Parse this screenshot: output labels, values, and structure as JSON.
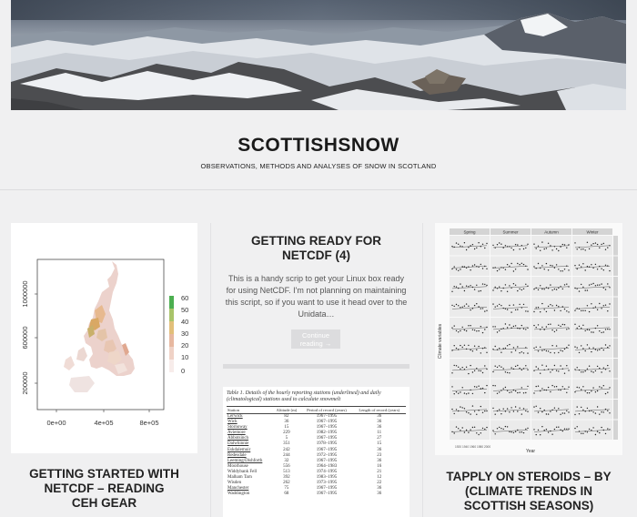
{
  "site": {
    "title": "SCOTTISHSNOW",
    "tagline": "OBSERVATIONS, METHODS AND ANALYSES OF SNOW IN SCOTLAND"
  },
  "posts": [
    {
      "title_lines": [
        "GETTING STARTED WITH",
        "NETCDF – READING",
        "CEH GEAR"
      ],
      "map_plot": {
        "y_ticks": [
          "1000000",
          "600000",
          "200000"
        ],
        "x_ticks": [
          "0e+00",
          "4e+05",
          "8e+05"
        ],
        "legend_ticks": [
          "60",
          "50",
          "40",
          "30",
          "20",
          "10",
          "0"
        ]
      }
    },
    {
      "title_lines": [
        "GETTING READY FOR",
        "NETCDF (4)"
      ],
      "excerpt": "This is a handy scrip to get your Linux box ready for using NetCDF. I'm not planning on maintaining this script, so if you want to use it head over to the Unidata…",
      "continue_label_1": "Continue",
      "continue_label_2": "reading →",
      "table": {
        "caption": "Table 1. Details of the hourly reporting stations (underlined) and daily (climatological) stations used to calculate snowmelt",
        "headers": [
          "Station",
          "Altitude (m)",
          "Period of record (years)",
          "Length of record (years)"
        ],
        "rows": [
          [
            "Lerwick",
            "82",
            "1967–1995",
            "36"
          ],
          [
            "Wick",
            "36",
            "1967–1995",
            "36"
          ],
          [
            "Stornoway",
            "15",
            "1967–1995",
            "36"
          ],
          [
            "Aviemore",
            "229",
            "1982–1995",
            "11"
          ],
          [
            "Abbotsinch",
            "5",
            "1967–1995",
            "27"
          ],
          [
            "Dalwhinnie",
            "351",
            "1978–1995",
            "15"
          ],
          [
            "Eskdalemuir",
            "242",
            "1967–1995",
            "36"
          ],
          [
            "Redesdale",
            "244",
            "1972–1995",
            "23"
          ],
          [
            "Leeming/Dishforth",
            "32",
            "1967–1995",
            "36"
          ],
          [
            "Moorhouse",
            "556",
            "1964–1983",
            "16"
          ],
          [
            "Widdybank Fell",
            "513",
            "1974–1995",
            "21"
          ],
          [
            "Malham Tarn",
            "392",
            "1983–1995",
            "12"
          ],
          [
            "Wisden",
            "262",
            "1973–1995",
            "22"
          ],
          [
            "Manchester",
            "75",
            "1967–1995",
            "36"
          ],
          [
            "Waddington",
            "68",
            "1967–1995",
            "36"
          ]
        ]
      }
    },
    {
      "title_lines": [
        "TAPPLY ON STEROIDS – BY",
        "(CLIMATE TRENDS IN",
        "SCOTTISH SEASONS)"
      ],
      "facet_plot": {
        "seasons": [
          "Spring",
          "Summer",
          "Autumn",
          "Winter"
        ],
        "x_label": "Year",
        "y_label": "Climate variables",
        "x_ticks": [
          "1920",
          "1940",
          "1960",
          "1980",
          "2000"
        ]
      }
    }
  ]
}
